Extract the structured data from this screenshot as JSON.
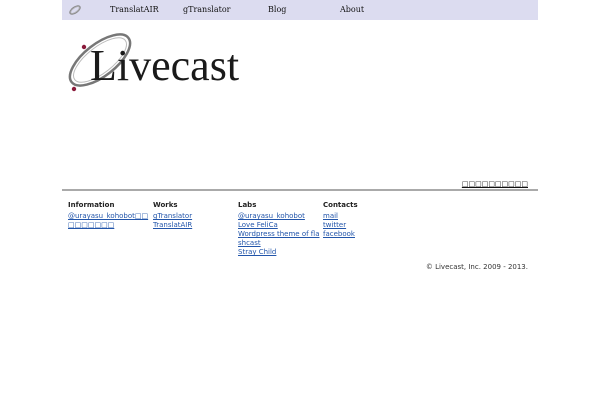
{
  "nav": {
    "items": [
      {
        "label": "TranslatAIR"
      },
      {
        "label": "gTranslator"
      },
      {
        "label": "Blog"
      },
      {
        "label": "About"
      }
    ]
  },
  "brand": {
    "name": "Livecast"
  },
  "header_link": "□□□□□□□□□□",
  "footer": {
    "columns": [
      {
        "title": "Information",
        "links": [
          "@urayasu_kohobot□□□□□□□□□"
        ]
      },
      {
        "title": "Works",
        "links": [
          "gTranslator",
          "TranslatAIR"
        ]
      },
      {
        "title": "Labs",
        "links": [
          "@urayasu_kohobot",
          "Love FeliCa",
          "Wordpress theme of flashcast",
          "Stray Child"
        ]
      },
      {
        "title": "Contacts",
        "links": [
          "mail",
          "twitter",
          "facebook"
        ]
      }
    ],
    "copyright": "© Livecast, Inc. 2009 - 2013."
  },
  "colors": {
    "nav_bg": "#dcdcf0",
    "link": "#2255aa",
    "rule": "#aaaaaa",
    "logo_accent": "#8a1a3a"
  }
}
